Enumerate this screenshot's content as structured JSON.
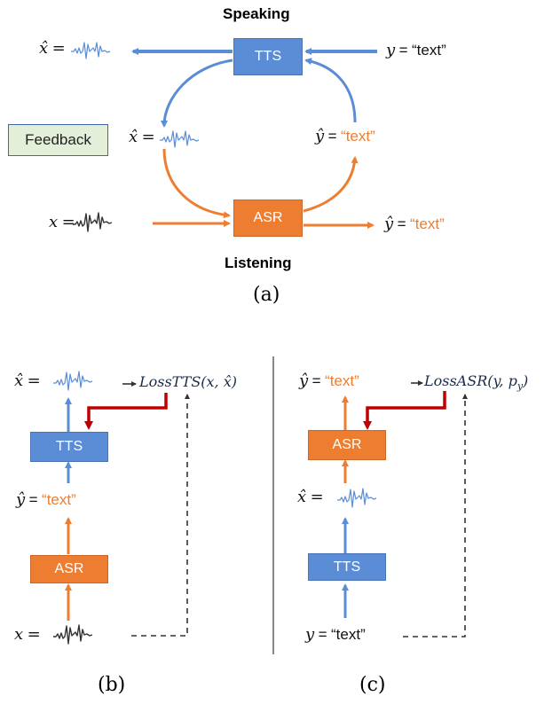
{
  "panel_a": {
    "top_label": "Speaking",
    "bottom_label": "Listening",
    "caption": "(a)",
    "tts_label": "TTS",
    "asr_label": "ASR",
    "feedback_label": "Feedback",
    "x_hat_symbol": "x̂",
    "x_symbol": "x",
    "y_symbol": "y",
    "y_hat_symbol": "ŷ",
    "equals": "=",
    "y_text": "“text”",
    "y_hat_text_open": "“",
    "y_hat_text_word": "text",
    "y_hat_text_close": "”"
  },
  "panel_b": {
    "caption": "(b)",
    "tts_label": "TTS",
    "asr_label": "ASR",
    "x_hat_symbol": "x̂",
    "x_symbol": "x",
    "y_hat_symbol": "ŷ",
    "equals": "=",
    "y_hat_text_open": "“",
    "y_hat_text_word": "text",
    "y_hat_text_close": "”",
    "loss_label": "LossTTS(x, x̂)"
  },
  "panel_c": {
    "caption": "(c)",
    "tts_label": "TTS",
    "asr_label": "ASR",
    "x_hat_symbol": "x̂",
    "y_symbol": "y",
    "y_hat_symbol": "ŷ",
    "equals": "=",
    "y_text": "“text”",
    "y_hat_text_open": "“",
    "y_hat_text_word": "text",
    "y_hat_text_close": "”",
    "loss_label_main": "LossASR(y, p",
    "loss_label_sub": "y",
    "loss_label_end": ")"
  },
  "colors": {
    "tts_blue": "#5b8dd6",
    "asr_orange": "#ed7d31",
    "feedback_red": "#c00000",
    "feedback_box_fill": "#e3efd9",
    "dashed_line": "#333333",
    "divider": "#555555"
  }
}
